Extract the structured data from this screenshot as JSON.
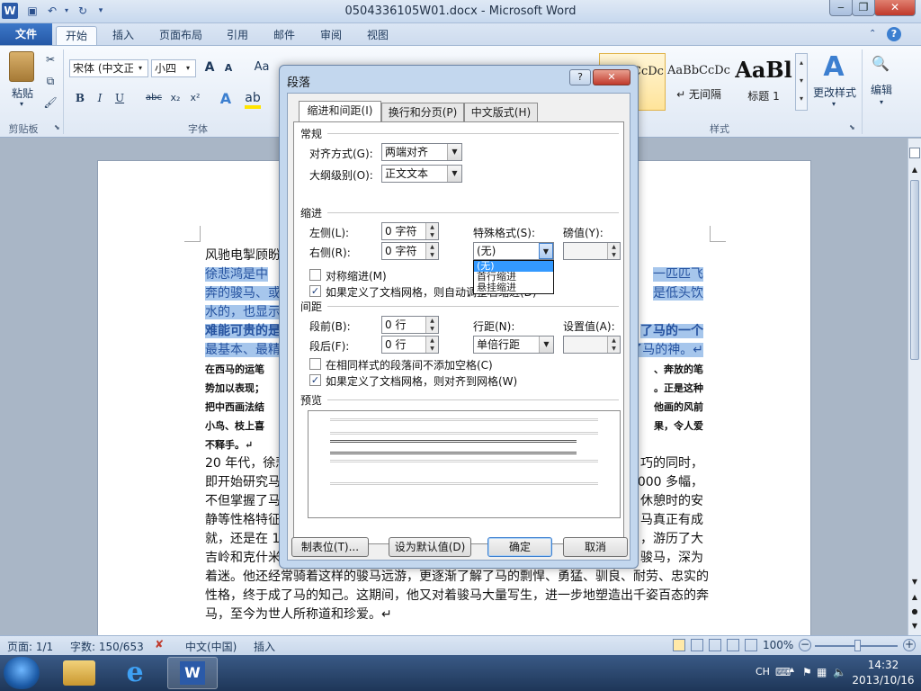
{
  "window": {
    "title": "0504336105W01.docx - Microsoft Word",
    "app_icon": "W"
  },
  "qat": [
    "save-icon",
    "undo-icon",
    "redo-icon",
    "customize-icon"
  ],
  "tabs": [
    "文件",
    "开始",
    "插入",
    "页面布局",
    "引用",
    "邮件",
    "审阅",
    "视图"
  ],
  "ribbon": {
    "clipboard": {
      "paste_label": "粘贴",
      "group": "剪贴板"
    },
    "font": {
      "font_name": "宋体 (中文正)",
      "font_size": "小四",
      "group": "字体",
      "grow": "A",
      "shrink": "A",
      "aa": "Aa",
      "bold": "B",
      "italic": "I",
      "underline": "U",
      "strike": "abc",
      "sub": "x₂",
      "sup": "x²"
    },
    "styles": {
      "group": "样式",
      "items": [
        {
          "preview": "AaBbCcDc",
          "name": "文"
        },
        {
          "preview": "AaBbCcDc",
          "name": "↵ 无间隔"
        },
        {
          "preview": "AaBl",
          "name": "标题 1"
        }
      ],
      "change_styles": "更改样式",
      "edit": "编辑"
    }
  },
  "document": {
    "lines": [
      {
        "text": "风驰电掣顾盼",
        "style": "normal"
      },
      {
        "text": "徐悲鸿是中",
        "tail": "一匹匹飞",
        "style": "sel"
      },
      {
        "text": "奔的骏马、或",
        "tail": "是低头饮",
        "style": "sel"
      },
      {
        "text": "水的，也显示",
        "tail": "",
        "style": "sel"
      },
      {
        "text": "难能可贵的是",
        "tail": "了马的一个",
        "style": "selbold"
      },
      {
        "text": "最基本、最精",
        "tail": "了马的神。↵",
        "style": "sel"
      },
      {
        "text": "在西马的运笔",
        "tail": "、奔放的笔",
        "style": "small"
      },
      {
        "text": "势加以表现；",
        "tail": "。正是这种",
        "style": "small"
      },
      {
        "text": "把中西画法结",
        "tail": "他画的风前",
        "style": "small"
      },
      {
        "text": "小鸟、枝上喜",
        "tail": "果，令人爱",
        "style": "small"
      },
      {
        "text": "不释手。↵",
        "tail": "",
        "style": "small"
      },
      {
        "text": "20 年代，徐悲",
        "tail": "巧的同时，",
        "style": "normal"
      },
      {
        "text": "即开始研究马",
        "tail": ",000 多幅，",
        "style": "normal"
      },
      {
        "text": "不但掌握了马",
        "tail": "休憩时的安",
        "style": "normal"
      },
      {
        "text": "静等性格特征",
        "tail": "马真正有成",
        "style": "normal"
      },
      {
        "text": "就，还是在 19",
        "tail": "，游历了大",
        "style": "normal"
      },
      {
        "text": "吉岭和克什米",
        "tail": "骏马，深为",
        "style": "normal"
      },
      {
        "text": "着迷。他还经常骑着这样的骏马远游，更逐渐了解了马的剽悍、勇猛、驯良、耐劳、忠实的",
        "tail": "",
        "style": "normal"
      },
      {
        "text": "性格，终于成了马的知己。这期间，他又对着骏马大量写生，进一步地塑造出千姿百态的奔",
        "tail": "",
        "style": "normal"
      },
      {
        "text": "马，至今为世人所称道和珍爱。↵",
        "tail": "",
        "style": "normal"
      }
    ]
  },
  "dialog": {
    "title": "段落",
    "tabs": [
      "缩进和间距(I)",
      "换行和分页(P)",
      "中文版式(H)"
    ],
    "general": {
      "heading": "常规",
      "align_label": "对齐方式(G):",
      "align_value": "两端对齐",
      "outline_label": "大纲级别(O):",
      "outline_value": "正文文本"
    },
    "indent": {
      "heading": "缩进",
      "left_label": "左侧(L):",
      "left_value": "0 字符",
      "right_label": "右侧(R):",
      "right_value": "0 字符",
      "special_label": "特殊格式(S):",
      "special_value": "(无)",
      "special_options": [
        "(无)",
        "首行缩进",
        "悬挂缩进"
      ],
      "by_label": "磅值(Y):",
      "by_value": "",
      "mirror_label": "对称缩进(M)",
      "mirror_checked": false,
      "grid_label": "如果定义了文档网格，则自动调整右缩进(D)",
      "grid_checked": true
    },
    "spacing": {
      "heading": "间距",
      "before_label": "段前(B):",
      "before_value": "0 行",
      "after_label": "段后(F):",
      "after_value": "0 行",
      "line_label": "行距(N):",
      "line_value": "单倍行距",
      "at_label": "设置值(A):",
      "at_value": "",
      "nospace_label": "在相同样式的段落间不添加空格(C)",
      "nospace_checked": false,
      "snap_label": "如果定义了文档网格，则对齐到网格(W)",
      "snap_checked": true
    },
    "preview": {
      "heading": "预览"
    },
    "buttons": {
      "tabs": "制表位(T)...",
      "default": "设为默认值(D)",
      "ok": "确定",
      "cancel": "取消"
    }
  },
  "status": {
    "page": "页面: 1/1",
    "words": "字数: 150/653",
    "lang": "中文(中国)",
    "mode": "插入",
    "zoom": "100%"
  },
  "tray": {
    "lang": "CH",
    "time": "14:32",
    "date": "2013/10/16"
  }
}
